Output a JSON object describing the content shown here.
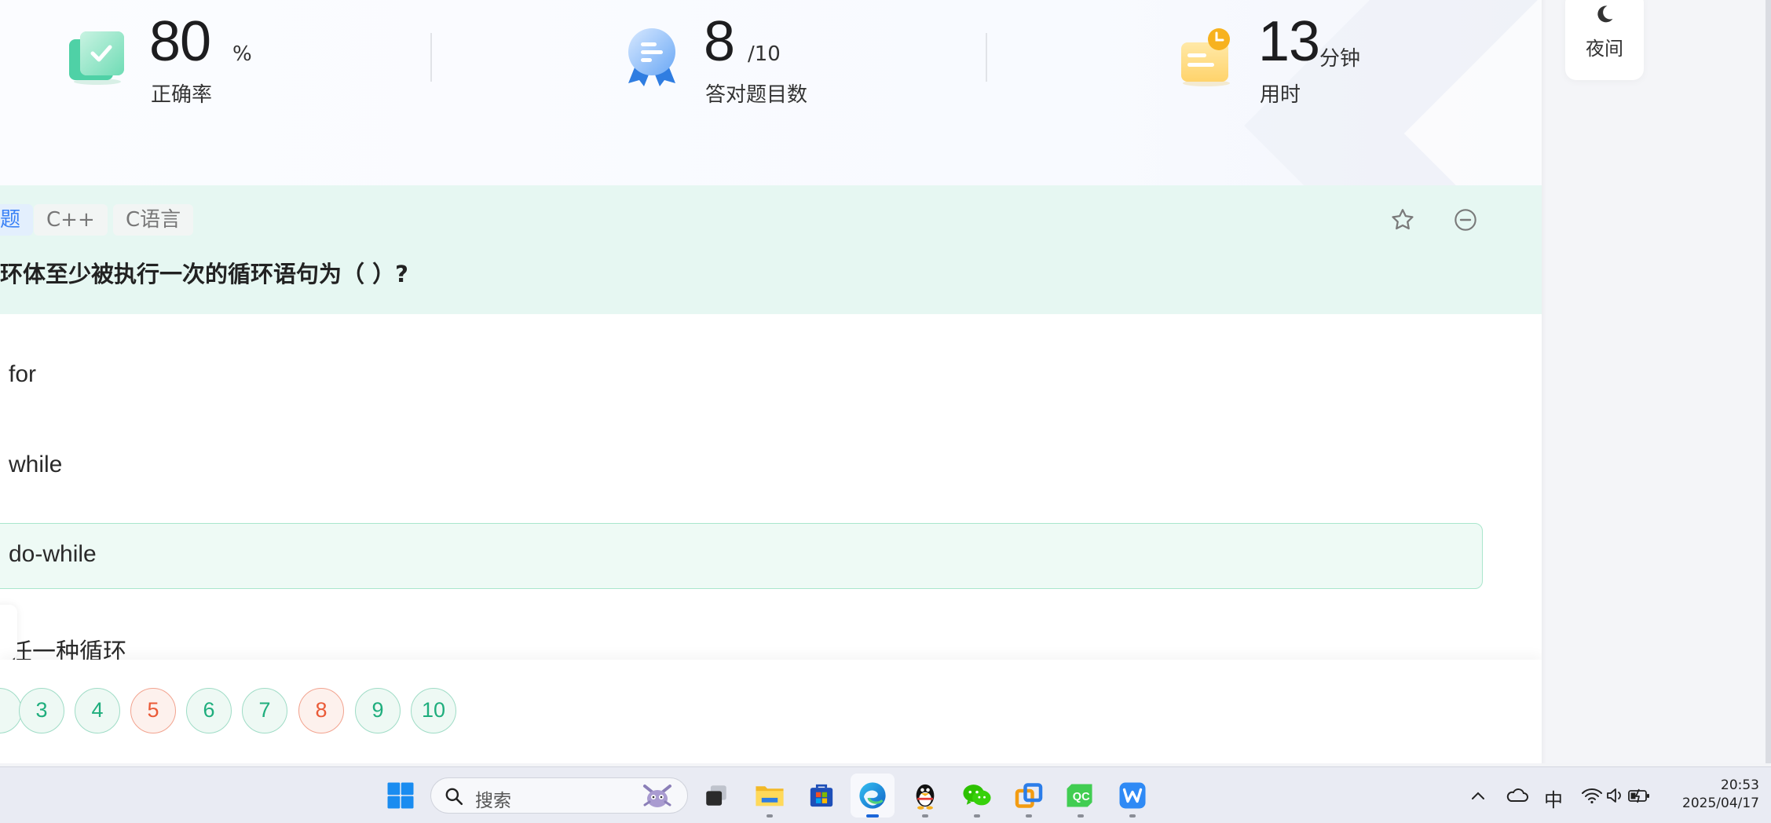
{
  "stats": {
    "accuracy": {
      "value": "80",
      "unit": "%",
      "label": "正确率",
      "icon": "check-card-icon"
    },
    "correct": {
      "value": "8",
      "unit": "/10",
      "label": "答对题目数",
      "icon": "medal-icon"
    },
    "time": {
      "value": "13",
      "unit": "分钟",
      "label": "用时",
      "icon": "clock-note-icon"
    }
  },
  "question": {
    "type_tag": "题",
    "tags": [
      "C++",
      "C语言"
    ],
    "text": "环体至少被执行一次的循环语句为（ ）?",
    "options": [
      {
        "text": "for",
        "selected": false
      },
      {
        "text": "while",
        "selected": false
      },
      {
        "text": "do-while",
        "selected": true
      },
      {
        "text": "任一种循环",
        "selected": false
      }
    ]
  },
  "side": {
    "night_label": "夜间"
  },
  "nav": {
    "numbers": [
      {
        "label": "3",
        "status": "correct"
      },
      {
        "label": "4",
        "status": "correct"
      },
      {
        "label": "5",
        "status": "wrong"
      },
      {
        "label": "6",
        "status": "correct"
      },
      {
        "label": "7",
        "status": "correct"
      },
      {
        "label": "8",
        "status": "wrong"
      },
      {
        "label": "9",
        "status": "correct"
      },
      {
        "label": "10",
        "status": "correct"
      }
    ]
  },
  "taskbar": {
    "search_placeholder": "搜索",
    "ime": "中",
    "time": "20:53",
    "date": "2025/04/17"
  },
  "colors": {
    "accent_green": "#1fae7d",
    "wrong_red": "#ea5a37",
    "question_bg": "#e6f7f2",
    "selected_bg": "#eefaf5"
  }
}
